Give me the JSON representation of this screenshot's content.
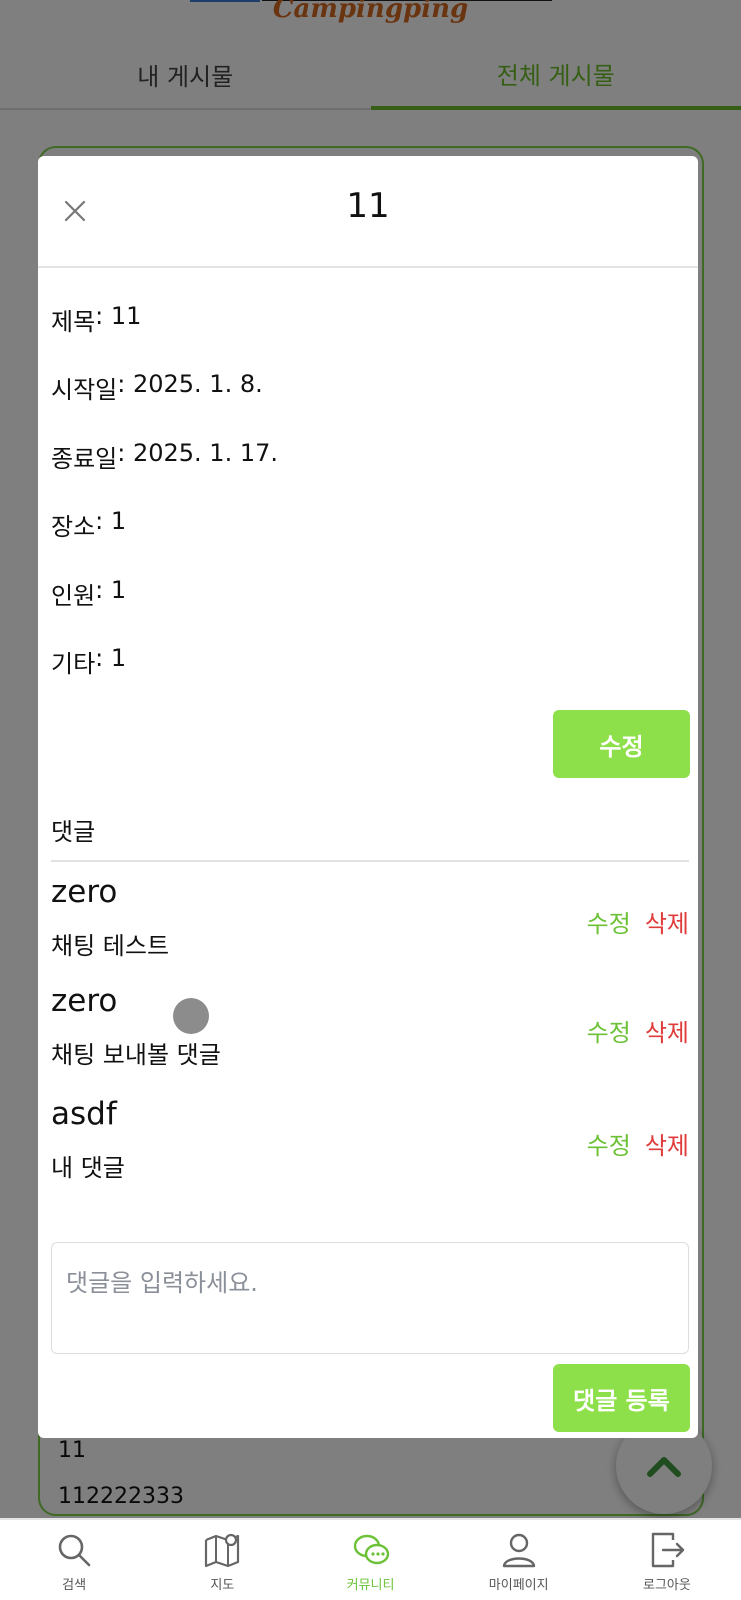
{
  "header": {
    "logo_text": "Campingping"
  },
  "tabs": [
    {
      "label": "내 게시물",
      "active": false
    },
    {
      "label": "전체 게시물",
      "active": true
    }
  ],
  "background_card": {
    "title": "11",
    "content": "112222333"
  },
  "modal": {
    "title": "11",
    "details": [
      {
        "label": "제목",
        "value": "11"
      },
      {
        "label": "시작일",
        "value": "2025. 1. 8."
      },
      {
        "label": "종료일",
        "value": "2025. 1. 17."
      },
      {
        "label": "장소",
        "value": "1"
      },
      {
        "label": "인원",
        "value": "1"
      },
      {
        "label": "기타",
        "value": "1"
      }
    ],
    "edit_button_label": "수정",
    "comments_heading": "댓글",
    "comments": [
      {
        "author": "zero",
        "text": "채팅 테스트",
        "edit_label": "수정",
        "delete_label": "삭제"
      },
      {
        "author": "zero",
        "text": "채팅 보내볼 댓글",
        "edit_label": "수정",
        "delete_label": "삭제"
      },
      {
        "author": "asdf",
        "text": "내 댓글",
        "edit_label": "수정",
        "delete_label": "삭제"
      }
    ],
    "comment_input_placeholder": "댓글을 입력하세요.",
    "submit_button_label": "댓글 등록"
  },
  "bottom_nav": [
    {
      "label": "검색",
      "icon": "search-icon",
      "active": false
    },
    {
      "label": "지도",
      "icon": "map-icon",
      "active": false
    },
    {
      "label": "커뮤니티",
      "icon": "chat-icon",
      "active": true
    },
    {
      "label": "마이페이지",
      "icon": "user-icon",
      "active": false
    },
    {
      "label": "로그아웃",
      "icon": "logout-icon",
      "active": false
    }
  ],
  "colors": {
    "accent": "#8ee04a",
    "accent_text": "#6cc236",
    "delete": "#e03b3b",
    "logo": "#d2691e"
  }
}
